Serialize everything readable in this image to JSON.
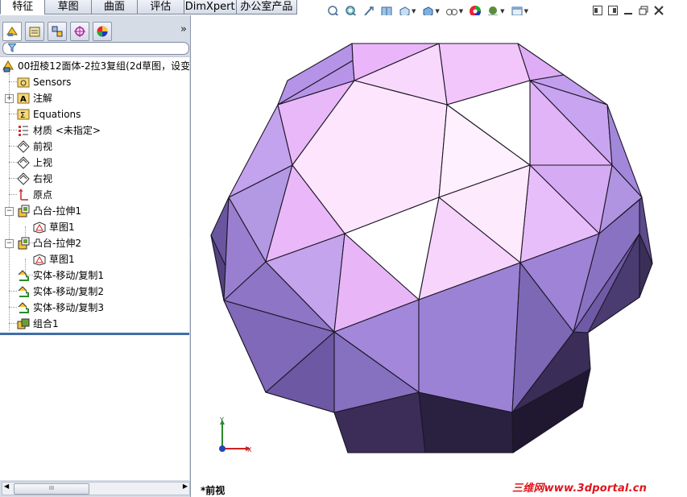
{
  "tabs": [
    "特征",
    "草图",
    "曲面",
    "评估",
    "DimXpert",
    "办公室产品"
  ],
  "active_tab": "特征",
  "toolbar_icons": [
    "zoom-to-fit-icon",
    "zoom-area-icon",
    "previous-view-icon",
    "section-view-icon",
    "view-orientation-icon",
    "display-style-icon",
    "hide-show-icon",
    "edit-appearance-icon",
    "apply-scene-icon",
    "view-settings-icon"
  ],
  "window_controls": [
    "tile-left-icon",
    "tile-right-icon",
    "minimize-icon",
    "restore-icon",
    "close-icon"
  ],
  "pane_tabs": [
    "featuremanager-tab",
    "propertymanager-tab",
    "configurationmanager-tab",
    "dimxpert-tab",
    "display-manager-tab"
  ],
  "pane_expand": "»",
  "tree": {
    "root": "00扭棱12面体-2拉3复组(2d草图，设变",
    "items": [
      {
        "label": "Sensors",
        "icon": "sensors-folder-icon"
      },
      {
        "label": "注解",
        "icon": "annotations-icon"
      },
      {
        "label": "Equations",
        "icon": "equations-icon"
      },
      {
        "label": "材质 <未指定>",
        "icon": "material-icon"
      },
      {
        "label": "前视",
        "icon": "plane-icon"
      },
      {
        "label": "上视",
        "icon": "plane-icon"
      },
      {
        "label": "右视",
        "icon": "plane-icon"
      },
      {
        "label": "原点",
        "icon": "origin-icon"
      },
      {
        "label": "凸台-拉伸1",
        "icon": "boss-extrude-icon"
      },
      {
        "label": "草图1",
        "icon": "sketch-icon"
      },
      {
        "label": "凸台-拉伸2",
        "icon": "boss-extrude-icon"
      },
      {
        "label": "草图1",
        "icon": "sketch-icon"
      },
      {
        "label": "实体-移动/复制1",
        "icon": "move-copy-body-icon"
      },
      {
        "label": "实体-移动/复制2",
        "icon": "move-copy-body-icon"
      },
      {
        "label": "实体-移动/复制3",
        "icon": "move-copy-body-icon"
      },
      {
        "label": "组合1",
        "icon": "combine-icon"
      }
    ]
  },
  "scrollbar_grip": "III",
  "view_name": "*前视",
  "triad": {
    "y": "Y",
    "x": "X"
  },
  "watermark": "三维网www.3dportal.cn",
  "colors": {
    "accent": "#3d6ea8",
    "watermark": "#e0141c",
    "pane": "#d6dce6"
  }
}
